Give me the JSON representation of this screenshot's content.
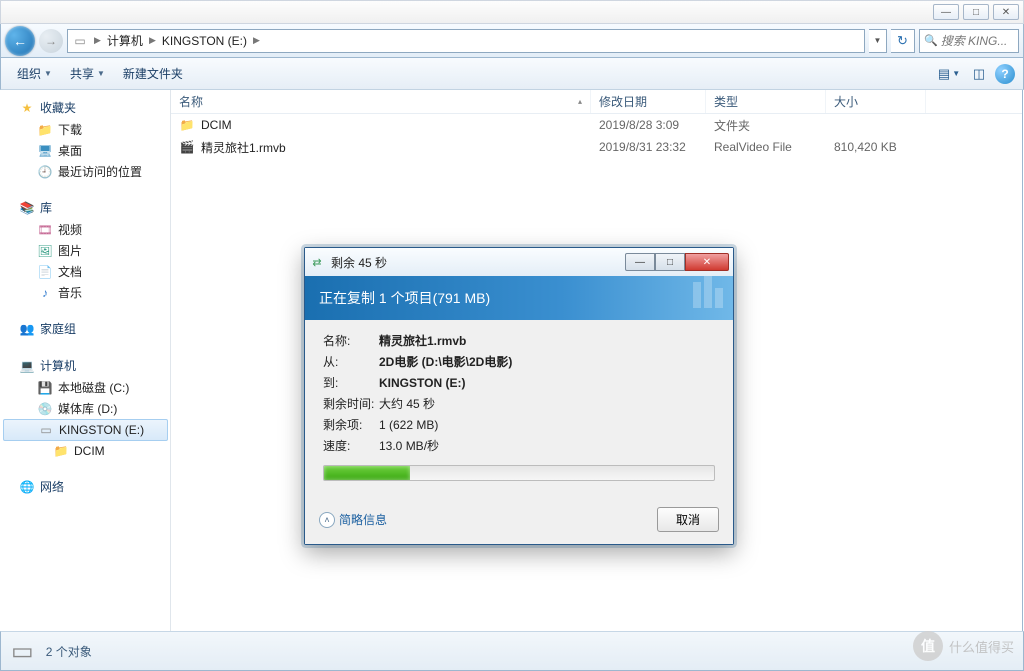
{
  "chrome": {
    "min": "—",
    "max": "□",
    "close": "✕"
  },
  "nav": {
    "back": "←",
    "fwd": "→",
    "segs": [
      "计算机",
      "KINGSTON (E:)"
    ],
    "refresh": "↻",
    "search_placeholder": "搜索 KING..."
  },
  "toolbar": {
    "organize": "组织",
    "share": "共享",
    "newfolder": "新建文件夹",
    "help": "?"
  },
  "sidebar": {
    "fav": {
      "head": "收藏夹",
      "items": [
        {
          "icon": "folder",
          "label": "下载"
        },
        {
          "icon": "desktop",
          "label": "桌面"
        },
        {
          "icon": "recent",
          "label": "最近访问的位置"
        }
      ]
    },
    "lib": {
      "head": "库",
      "items": [
        {
          "icon": "video",
          "label": "视频"
        },
        {
          "icon": "pic",
          "label": "图片"
        },
        {
          "icon": "doc",
          "label": "文档"
        },
        {
          "icon": "music",
          "label": "音乐"
        }
      ]
    },
    "home": {
      "head": "家庭组"
    },
    "comp": {
      "head": "计算机",
      "items": [
        {
          "icon": "drive",
          "label": "本地磁盘 (C:)"
        },
        {
          "icon": "drive",
          "label": "媒体库 (D:)"
        },
        {
          "icon": "drive",
          "label": "KINGSTON (E:)",
          "sel": true
        },
        {
          "icon": "folder",
          "label": "DCIM",
          "indent": true
        }
      ]
    },
    "net": {
      "head": "网络"
    }
  },
  "cols": {
    "name": "名称",
    "date": "修改日期",
    "type": "类型",
    "size": "大小"
  },
  "rows": [
    {
      "icon": "folder",
      "name": "DCIM",
      "date": "2019/8/28 3:09",
      "type": "文件夹",
      "size": ""
    },
    {
      "icon": "video",
      "name": "精灵旅社1.rmvb",
      "date": "2019/8/31 23:32",
      "type": "RealVideo File",
      "size": "810,420 KB"
    }
  ],
  "status": {
    "count": "2 个对象"
  },
  "dialog": {
    "title": "剩余 45 秒",
    "header": "正在复制 1 个项目(791 MB)",
    "labels": {
      "name": "名称:",
      "from": "从:",
      "to": "到:",
      "remaining": "剩余时间:",
      "items": "剩余项:",
      "speed": "速度:"
    },
    "values": {
      "name": "精灵旅社1.rmvb",
      "from": "2D电影 (D:\\电影\\2D电影)",
      "to": "KINGSTON (E:)",
      "remaining": "大约 45 秒",
      "items": "1 (622 MB)",
      "speed": "13.0 MB/秒"
    },
    "expand": "简略信息",
    "cancel": "取消"
  },
  "watermark": {
    "text": "什么值得买",
    "glyph": "值"
  }
}
